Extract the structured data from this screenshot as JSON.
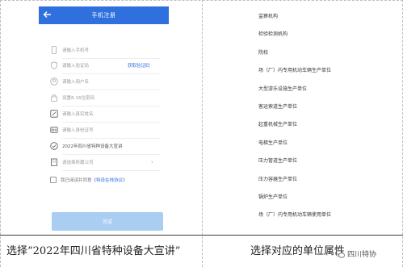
{
  "header": {
    "title": "手机注册"
  },
  "form": {
    "phone_placeholder": "请输入手机号",
    "code_placeholder": "请输入验证码",
    "get_code_link": "获取验证码",
    "username_placeholder": "请输入用户名",
    "password_placeholder": "设置6-16位密码",
    "realname_placeholder": "请输入真实姓名",
    "idcard_placeholder": "请输入身份证号",
    "event_value": "2022年四川省特种设备大宣讲",
    "company_placeholder": "请选择所属公司",
    "agree_text": "我已阅读并同意",
    "agree_link": "《特设在线协议》",
    "submit_label": "完成"
  },
  "unit_types": [
    "监察机构",
    "检验检测机构",
    "院校",
    "场（厂）内专用机动车辆生产单位",
    "大型游乐设施生产单位",
    "客运索道生产单位",
    "起重机械生产单位",
    "电梯生产单位",
    "压力管道生产单位",
    "压力容器生产单位",
    "锅炉生产单位",
    "场（厂）内专用机动车辆使用单位"
  ],
  "captions": {
    "left": "选择“2022年四川省特种设备大宣讲”",
    "right": "选择对应的单位属性"
  },
  "brand": {
    "name": "四川特协"
  },
  "colors": {
    "accent": "#2f6fde",
    "button": "#aacdf2"
  }
}
